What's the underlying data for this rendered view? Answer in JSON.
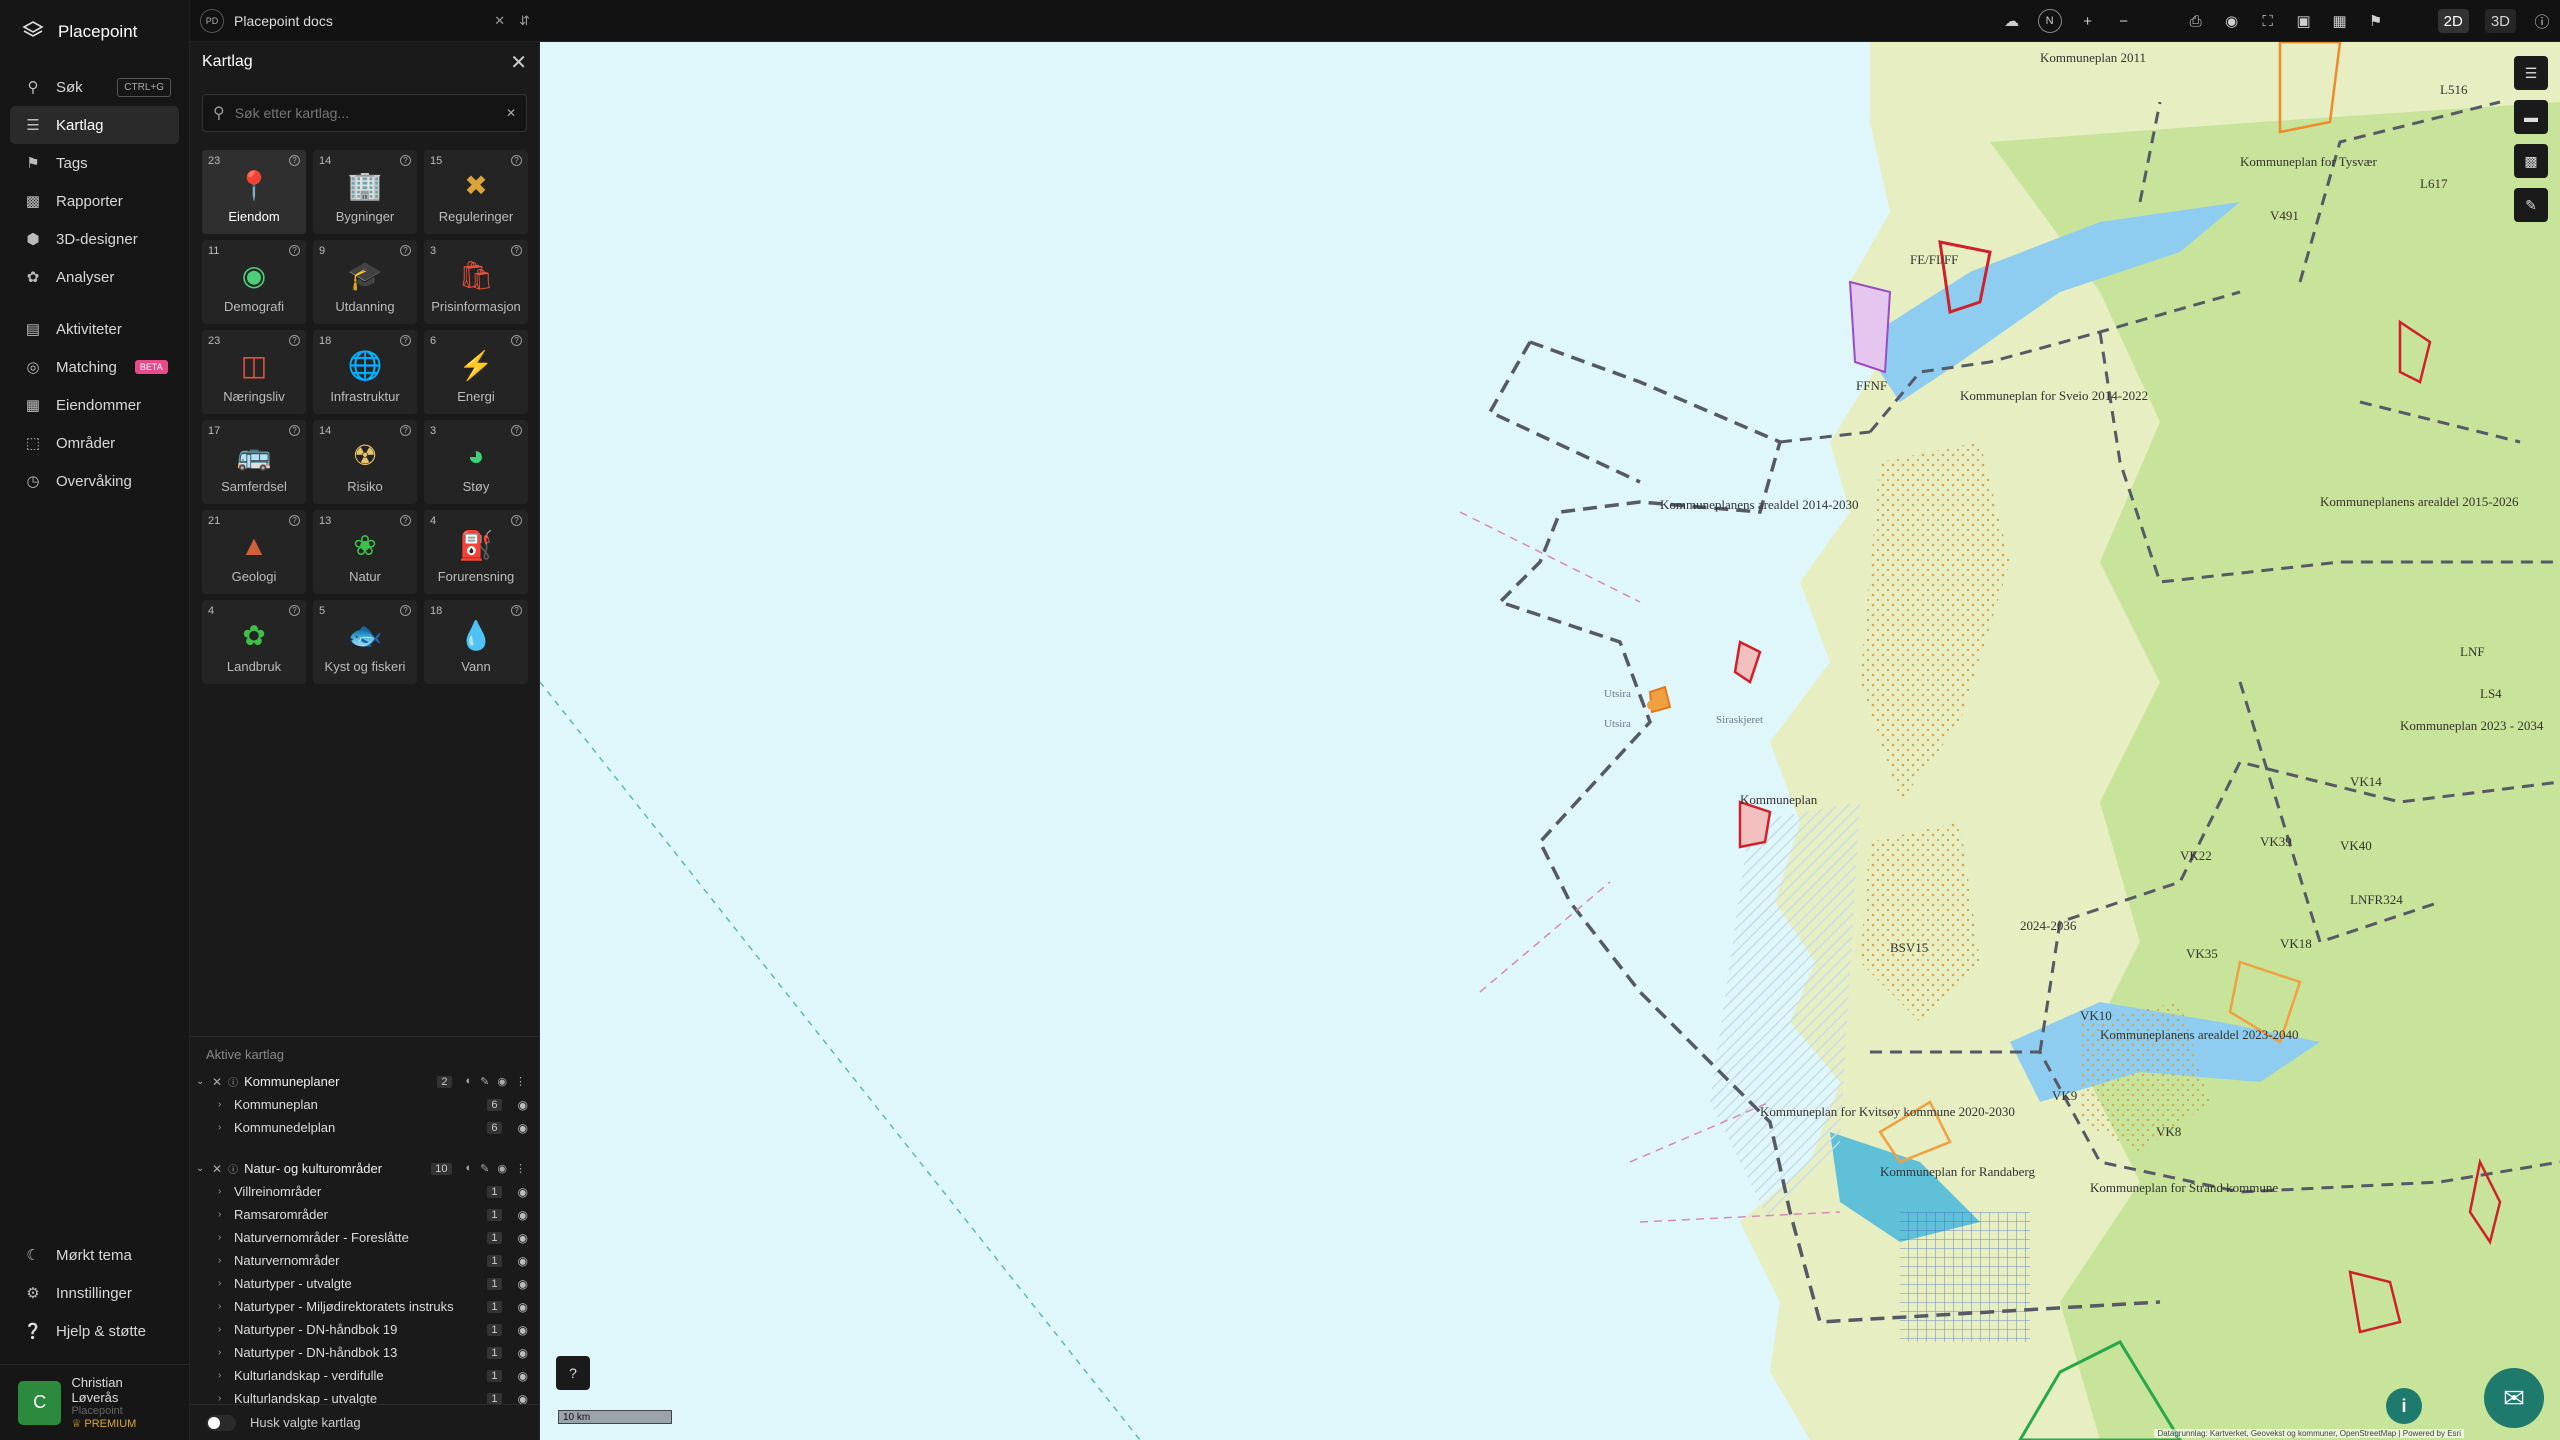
{
  "app": {
    "name": "Placepoint"
  },
  "nav": {
    "items": [
      {
        "label": "Søk",
        "shortcut": "CTRL+G"
      },
      {
        "label": "Kartlag"
      },
      {
        "label": "Tags"
      },
      {
        "label": "Rapporter"
      },
      {
        "label": "3D-designer"
      },
      {
        "label": "Analyser"
      },
      {
        "label": "Aktiviteter"
      },
      {
        "label": "Matching",
        "badge": "BETA"
      },
      {
        "label": "Eiendommer"
      },
      {
        "label": "Områder"
      },
      {
        "label": "Overvåking"
      }
    ],
    "bottom": [
      {
        "label": "Mørkt tema"
      },
      {
        "label": "Innstillinger"
      },
      {
        "label": "Hjelp & støtte"
      }
    ],
    "user": {
      "initial": "C",
      "name": "Christian Løverås",
      "org": "Placepoint",
      "plan": "PREMIUM"
    }
  },
  "topbar": {
    "workspace": {
      "badge": "PD",
      "name": "Placepoint docs"
    },
    "compass": "N",
    "mode_2d": "2D",
    "mode_3d": "3D"
  },
  "panel": {
    "title": "Kartlag",
    "search_placeholder": "Søk etter kartlag...",
    "categories": [
      {
        "count": "23",
        "label": "Eiendom",
        "icon": "pin-icon"
      },
      {
        "count": "14",
        "label": "Bygninger",
        "icon": "building-icon"
      },
      {
        "count": "15",
        "label": "Reguleringer",
        "icon": "signpost-icon"
      },
      {
        "count": "11",
        "label": "Demografi",
        "icon": "people-icon"
      },
      {
        "count": "9",
        "label": "Utdanning",
        "icon": "graduation-icon"
      },
      {
        "count": "3",
        "label": "Prisinformasjon",
        "icon": "bag-icon"
      },
      {
        "count": "23",
        "label": "Næringsliv",
        "icon": "shop-icon"
      },
      {
        "count": "18",
        "label": "Infrastruktur",
        "icon": "globe-icon"
      },
      {
        "count": "6",
        "label": "Energi",
        "icon": "lightning-icon"
      },
      {
        "count": "17",
        "label": "Samferdsel",
        "icon": "bus-icon"
      },
      {
        "count": "14",
        "label": "Risiko",
        "icon": "hazard-icon"
      },
      {
        "count": "3",
        "label": "Støy",
        "icon": "noise-icon"
      },
      {
        "count": "21",
        "label": "Geologi",
        "icon": "terrain-icon"
      },
      {
        "count": "13",
        "label": "Natur",
        "icon": "leaf-icon"
      },
      {
        "count": "4",
        "label": "Forurensning",
        "icon": "factory-icon"
      },
      {
        "count": "4",
        "label": "Landbruk",
        "icon": "sprout-icon"
      },
      {
        "count": "5",
        "label": "Kyst og fiskeri",
        "icon": "fish-icon"
      },
      {
        "count": "18",
        "label": "Vann",
        "icon": "drop-icon"
      }
    ],
    "active_title": "Aktive kartlag",
    "groups": [
      {
        "name": "Kommuneplaner",
        "count": "2",
        "layers": [
          {
            "name": "Kommuneplan",
            "count": "6"
          },
          {
            "name": "Kommunedelplan",
            "count": "6"
          }
        ]
      },
      {
        "name": "Natur- og kulturområder",
        "count": "10",
        "layers": [
          {
            "name": "Villreinområder",
            "count": "1"
          },
          {
            "name": "Ramsarområder",
            "count": "1"
          },
          {
            "name": "Naturvernområder - Foreslåtte",
            "count": "1"
          },
          {
            "name": "Naturvernområder",
            "count": "1"
          },
          {
            "name": "Naturtyper - utvalgte",
            "count": "1"
          },
          {
            "name": "Naturtyper - Miljødirektoratets instruks",
            "count": "1"
          },
          {
            "name": "Naturtyper - DN-håndbok 19",
            "count": "1"
          },
          {
            "name": "Naturtyper - DN-håndbok 13",
            "count": "1"
          },
          {
            "name": "Kulturlandskap - verdifulle",
            "count": "1"
          },
          {
            "name": "Kulturlandskap - utvalgte",
            "count": "1"
          }
        ]
      }
    ],
    "remember_label": "Husk valgte kartlag"
  },
  "map": {
    "labels": [
      "Kommuneplanens arealdel 2014-2030",
      "Kommuneplan for Sveio 2014-2022",
      "Kommuneplan for Kvitsøy kommune 2020-2030",
      "Kommuneplanens arealdel 2023-2040",
      "Kommuneplan for Randaberg",
      "Kommuneplan for Strand kommune",
      "Kommuneplan",
      "Kommuneplan for Tysvær",
      "Kommuneplan 2011",
      "Kommuneplanens arealdel 2015-2026",
      "Utsira",
      "Utsira",
      "Siraskjeret",
      "VK39",
      "VK40",
      "VK22",
      "VK35",
      "VK18",
      "VK10",
      "VK9",
      "VK8",
      "LNFR324",
      "LNF",
      "LS4",
      "VK14",
      "BSV15",
      "2024-2036",
      "FE/FI/FF",
      "FFNF",
      "V491",
      "L516",
      "L617",
      "Kommuneplan 2023 - 2034"
    ],
    "scale": "10 km",
    "attribution": "Datagrunnlag: Kartverket, Geovekst og kommuner, OpenStreetMap | Powered by Esri"
  }
}
